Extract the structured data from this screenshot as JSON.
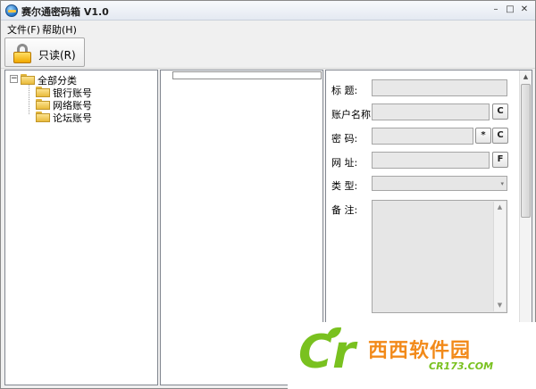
{
  "window": {
    "title": "赛尔通密码箱 V1.0",
    "controls": {
      "minimize": "–",
      "maximize": "□",
      "close": "✕"
    }
  },
  "menu": {
    "file": "文件(F)",
    "help": "帮助(H)"
  },
  "toolbar": {
    "readonly_label": "只读(R)",
    "readonly_icon": "lock-icon"
  },
  "tree": {
    "expander": "−",
    "root": {
      "label": "全部分类",
      "icon": "folder-icon"
    },
    "children": [
      {
        "label": "银行账号",
        "icon": "folder-icon"
      },
      {
        "label": "网络账号",
        "icon": "folder-icon"
      },
      {
        "label": "论坛账号",
        "icon": "folder-icon"
      }
    ]
  },
  "details": {
    "fields": {
      "title": {
        "label": "标    题:",
        "value": ""
      },
      "account": {
        "label": "账户名称:",
        "value": "",
        "copy_button": "C"
      },
      "password": {
        "label": "密    码:",
        "value": "",
        "mask_button": "*",
        "copy_button": "C"
      },
      "url": {
        "label": "网    址:",
        "value": "",
        "open_button": "F"
      },
      "type": {
        "label": "类    型:",
        "value": ""
      },
      "memo": {
        "label": "备    注:",
        "value": ""
      }
    },
    "scroll_up": "▲",
    "arrow_down": "▼"
  },
  "watermark": {
    "logo": "Cr",
    "site_name": "西西软件园",
    "domain": "CR173.COM",
    "colors": {
      "green": "#79c11f",
      "orange": "#f28a1a"
    }
  }
}
